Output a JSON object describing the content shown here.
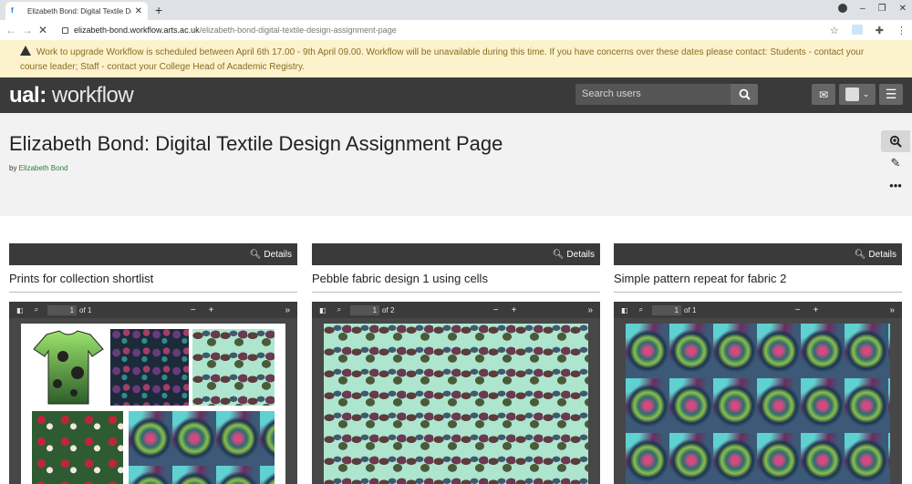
{
  "browser": {
    "tab_title": "Elizabeth Bond: Digital Textile De",
    "url_host": "elizabeth-bond.workflow.arts.ac.uk",
    "url_path": "/elizabeth-bond-digital-textile-design-assignment-page"
  },
  "banner": {
    "text": "Work to upgrade Workflow is scheduled between April 6th 17.00 - 9th April 09.00. Workflow will be unavailable during this time. If you have concerns over these dates please contact: Students - contact your course leader; Staff - contact your College Head of Academic Registry."
  },
  "header": {
    "logo_ual": "ual",
    "logo_sep": ":",
    "logo_workflow": " workflow",
    "search_placeholder": "Search users"
  },
  "page": {
    "title": "Elizabeth Bond: Digital Textile Design Assignment Page",
    "by_label": "by ",
    "author": "Elizabeth Bond"
  },
  "cards": [
    {
      "details_label": "Details",
      "title": "Prints for collection shortlist",
      "page_current": "1",
      "page_total": "of 1"
    },
    {
      "details_label": "Details",
      "title": "Pebble fabric design 1 using cells",
      "page_current": "1",
      "page_total": "of 2"
    },
    {
      "details_label": "Details",
      "title": "Simple pattern repeat for fabric 2",
      "page_current": "1",
      "page_total": "of 1"
    }
  ],
  "colors": {
    "banner_bg": "#fcf2cc",
    "banner_text": "#8a6d22",
    "header_bg": "#3a3a3a",
    "author_link": "#2e7d32"
  }
}
